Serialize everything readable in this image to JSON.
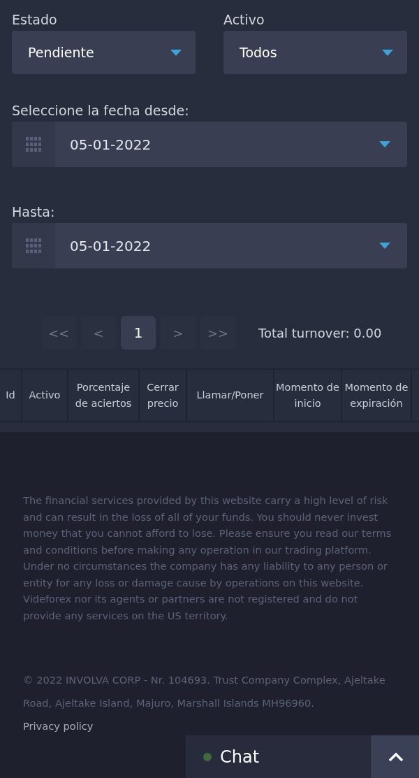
{
  "selects": [
    {
      "label": "Estado",
      "value": "Pendiente"
    },
    {
      "label": "Activo",
      "value": "Todos"
    }
  ],
  "date_fields": [
    {
      "label": "Seleccione la fecha desde:",
      "value": "05-01-2022"
    },
    {
      "label": "Hasta:",
      "value": "05-01-2022"
    }
  ],
  "pagination": [
    {
      "label": "<<",
      "selected": false
    },
    {
      "label": "<",
      "selected": false
    },
    {
      "label": "1",
      "selected": true
    },
    {
      "label": ">",
      "selected": false
    },
    {
      "label": ">>",
      "selected": false
    }
  ],
  "total_turnover": "Total turnover: 0.00",
  "table": {
    "columns": [
      "Id",
      "Activo",
      "Porcentaje de aciertos",
      "Cerrar precio",
      "Llamar/Poner",
      "Momento de inicio",
      "Momento de expiración"
    ]
  },
  "disclaimer": "The financial services provided by this website carry a high level of risk and can result in the loss of all of your funds. You should never invest money that you cannot afford to lose. Please ensure you read our terms and conditions before making any operation in our trading platform. Under no circumstances the company has any liability to any person or entity for any loss or damage cause by operations on this website. Videforex nor its agents or partners are not registered and do not provide any services on the US territory.",
  "copyright": "© 2022 INVOLVA CORP - Nr. 104693. Trust Company Complex, Ajeltake Road, Ajeltake Island, Majuro, Marshall Islands MH96960.",
  "privacy_link": "Privacy policy",
  "chat": {
    "label": "Chat",
    "online": true
  }
}
